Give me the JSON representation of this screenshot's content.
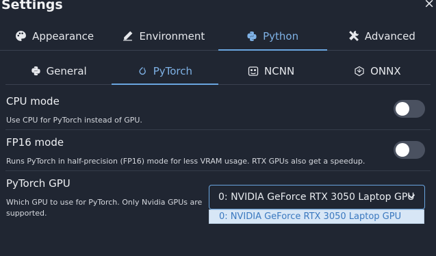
{
  "header": {
    "title": "Settings",
    "close_glyph": "×"
  },
  "tabs": [
    {
      "label": "Appearance",
      "icon": "palette-icon",
      "active": false
    },
    {
      "label": "Environment",
      "icon": "pen-icon",
      "active": false
    },
    {
      "label": "Python",
      "icon": "python-icon",
      "active": true
    },
    {
      "label": "Advanced",
      "icon": "tools-icon",
      "active": false
    }
  ],
  "subtabs": [
    {
      "label": "General",
      "icon": "python-icon",
      "active": false
    },
    {
      "label": "PyTorch",
      "icon": "pytorch-icon",
      "active": true
    },
    {
      "label": "NCNN",
      "icon": "ncnn-icon",
      "active": false
    },
    {
      "label": "ONNX",
      "icon": "onnx-icon",
      "active": false
    }
  ],
  "settings": {
    "cpu_mode": {
      "label": "CPU mode",
      "description": "Use CPU for PyTorch instead of GPU.",
      "enabled": false
    },
    "fp16_mode": {
      "label": "FP16 mode",
      "description": "Runs PyTorch in half-precision (FP16) mode for less VRAM usage. RTX GPUs also get a speedup.",
      "enabled": false
    },
    "gpu": {
      "label": "PyTorch GPU",
      "description": "Which GPU to use for PyTorch. Only Nvidia GPUs are supported.",
      "selected": "0: NVIDIA GeForce RTX 3050 Laptop GPU",
      "options": [
        "0: NVIDIA GeForce RTX 3050 Laptop GPU"
      ]
    }
  },
  "colors": {
    "background": "#202632",
    "accent": "#6aa6e0",
    "toggle_off": "#4a5160",
    "dropdown_highlight": "#d7e6f6"
  }
}
